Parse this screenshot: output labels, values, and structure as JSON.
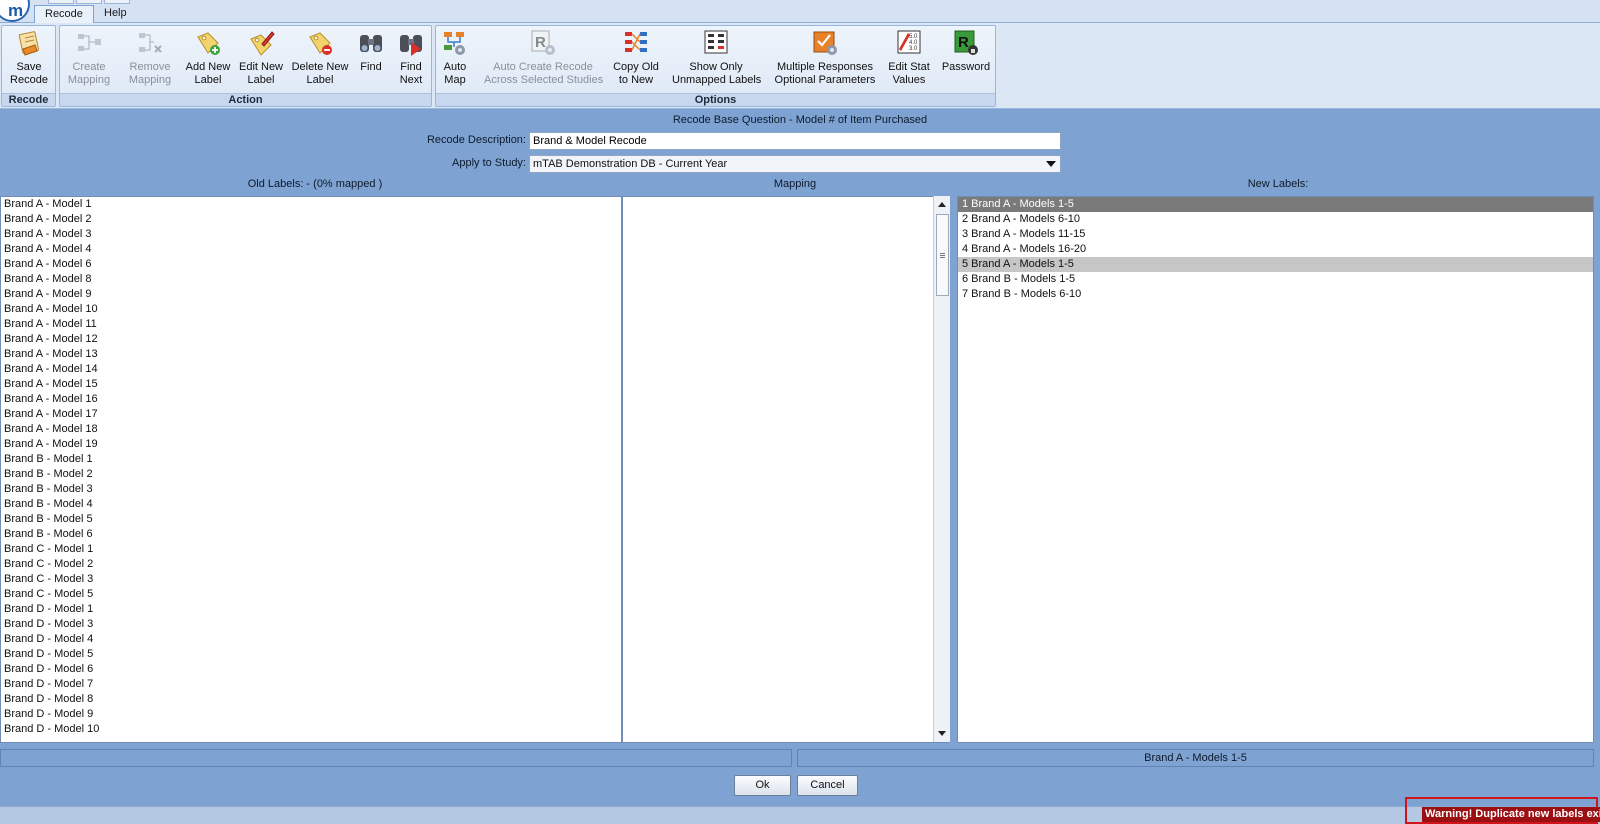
{
  "app": {
    "logo_letter": "m"
  },
  "tabs": [
    {
      "label": "Recode"
    },
    {
      "label": "Help"
    }
  ],
  "ribbon": {
    "groups": {
      "recode": "Recode",
      "action": "Action",
      "options": "Options"
    },
    "buttons": {
      "save_recode": {
        "line1": "Save",
        "line2": "Recode",
        "icon": "save-recode-icon"
      },
      "create_mapping": {
        "line1": "Create",
        "line2": "Mapping",
        "icon": "create-mapping-icon",
        "disabled": true
      },
      "remove_mapping": {
        "line1": "Remove",
        "line2": "Mapping",
        "icon": "remove-mapping-icon",
        "disabled": true
      },
      "add_new_label": {
        "line1": "Add New",
        "line2": "Label",
        "icon": "tag-add-icon"
      },
      "edit_new_label": {
        "line1": "Edit New",
        "line2": "Label",
        "icon": "tag-edit-icon"
      },
      "delete_new_label": {
        "line1": "Delete New",
        "line2": "Label",
        "icon": "tag-delete-icon"
      },
      "find": {
        "line1": "Find",
        "line2": "",
        "icon": "binoculars-icon"
      },
      "find_next": {
        "line1": "Find",
        "line2": "Next",
        "icon": "binoculars-next-icon"
      },
      "auto_map": {
        "line1": "Auto",
        "line2": "Map",
        "icon": "auto-map-icon"
      },
      "auto_create_recode": {
        "line1": "Auto Create Recode",
        "line2": "Across Selected Studies",
        "icon": "auto-recode-icon",
        "disabled": true
      },
      "copy_old_to_new": {
        "line1": "Copy Old",
        "line2": "to New",
        "icon": "copy-old-to-new-icon"
      },
      "show_only_unmapped": {
        "line1": "Show Only",
        "line2": "Unmapped Labels",
        "icon": "unmapped-labels-icon"
      },
      "multiple_responses": {
        "line1": "Multiple Responses",
        "line2": "Optional Parameters",
        "icon": "multiple-responses-icon"
      },
      "edit_stat_values": {
        "line1": "Edit Stat",
        "line2": "Values",
        "icon": "stat-values-icon"
      },
      "password": {
        "line1": "Password",
        "line2": "",
        "icon": "password-icon"
      }
    }
  },
  "form": {
    "title": "Recode Base Question - Model # of Item Purchased",
    "description_label": "Recode Description:",
    "description_value": "Brand & Model Recode",
    "study_label": "Apply to Study:",
    "study_value": "mTAB Demonstration DB - Current Year"
  },
  "columns": {
    "old": "Old Labels: - (0% mapped )",
    "mapping": "Mapping",
    "new": "New Labels:"
  },
  "old_labels": [
    "Brand A - Model 1",
    "Brand A - Model 2",
    "Brand A - Model 3",
    "Brand A - Model 4",
    "Brand A - Model 6",
    "Brand A - Model 8",
    "Brand A - Model 9",
    "Brand A - Model 10",
    "Brand A - Model 11",
    "Brand A - Model 12",
    "Brand A - Model 13",
    "Brand A - Model 14",
    "Brand A - Model 15",
    "Brand A - Model 16",
    "Brand A - Model 17",
    "Brand A - Model 18",
    "Brand A - Model 19",
    "Brand B - Model 1",
    "Brand B - Model 2",
    "Brand B - Model 3",
    "Brand B - Model 4",
    "Brand B - Model 5",
    "Brand B - Model 6",
    "Brand C - Model 1",
    "Brand C - Model 2",
    "Brand C - Model 3",
    "Brand C - Model 5",
    "Brand D - Model 1",
    "Brand D - Model 3",
    "Brand D - Model 4",
    "Brand D - Model 5",
    "Brand D - Model 6",
    "Brand D - Model 7",
    "Brand D - Model 8",
    "Brand D - Model 9",
    "Brand D - Model 10"
  ],
  "new_labels": [
    {
      "text": "1  Brand A - Models 1-5",
      "state": "selected"
    },
    {
      "text": "2  Brand A - Models 6-10",
      "state": ""
    },
    {
      "text": "3  Brand A - Models 11-15",
      "state": ""
    },
    {
      "text": "4  Brand A - Models 16-20",
      "state": ""
    },
    {
      "text": "5  Brand A - Models 1-5",
      "state": "duplicate"
    },
    {
      "text": "6  Brand B - Models 1-5",
      "state": ""
    },
    {
      "text": "7  Brand B - Models 6-10",
      "state": ""
    }
  ],
  "status": {
    "left": "",
    "right": "Brand A - Models 1-5"
  },
  "buttons": {
    "ok": "Ok",
    "cancel": "Cancel"
  },
  "warning": "Warning! Duplicate new labels exist.",
  "colors": {
    "background": "#7ea3d3",
    "selected_row": "#7a7a7a",
    "duplicate_row": "#c6c6c6",
    "warning_bg": "#9b0e12",
    "warning_border": "#d0141b"
  }
}
